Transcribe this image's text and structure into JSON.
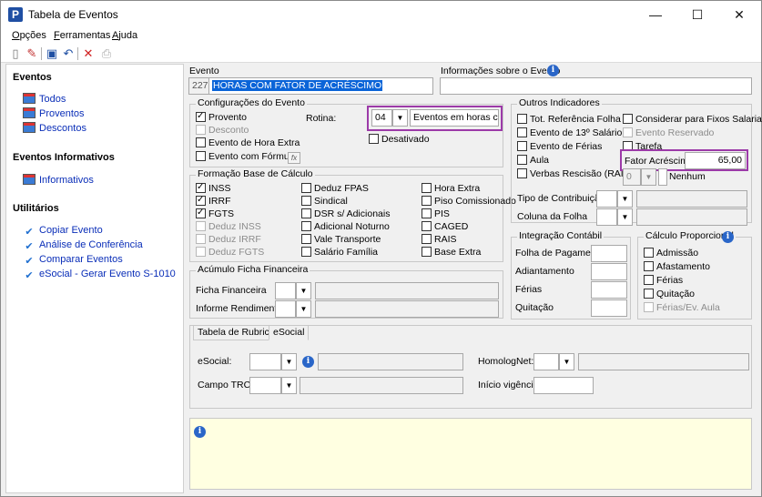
{
  "window": {
    "title": "Tabela de Eventos",
    "app_icon": "P",
    "minimize": "—",
    "maximize": "☐",
    "close": "✕"
  },
  "menu": [
    {
      "label": "Opções",
      "u": "O",
      "rest": "pções"
    },
    {
      "label": "Ferramentas",
      "u": "F",
      "rest": "erramentas"
    },
    {
      "label": "Ajuda",
      "u": "A",
      "rest": "juda"
    }
  ],
  "toolbar": {
    "icons": [
      "new-document-icon",
      "edit-icon",
      "save-icon",
      "undo-icon",
      "delete-icon",
      "print-icon"
    ]
  },
  "sidebar": {
    "eventos_head": "Eventos",
    "eventos": [
      "Todos",
      "Proventos",
      "Descontos"
    ],
    "informativos_head": "Eventos Informativos",
    "informativos": [
      "Informativos"
    ],
    "utilitarios_head": "Utilitários",
    "utilitarios": [
      "Copiar Evento",
      "Análise de Conferência",
      "Comparar Eventos",
      "eSocial - Gerar Evento S-1010"
    ]
  },
  "evento": {
    "label": "Evento",
    "code": "227",
    "name": "HORAS COM FATOR DE ACRÉSCIMO"
  },
  "info_evento": {
    "label": "Informações sobre o Evento",
    "value": ""
  },
  "config": {
    "title": "Configurações do Evento",
    "provento": "Provento",
    "desconto": "Desconto",
    "hora_extra": "Evento de Hora Extra",
    "formula": "Evento com Fórmula",
    "fx": "fx",
    "rotina_label": "Rotina:",
    "rotina_code": "04",
    "rotina_desc": "Eventos em horas com fator",
    "desativado": "Desativado"
  },
  "outros": {
    "title": "Outros Indicadores",
    "tot_ref": "Tot. Referência Folha",
    "decimo": "Evento de 13º Salário",
    "ferias": "Evento de Férias",
    "aula": "Aula",
    "verbas": "Verbas Rescisão (RAIS)",
    "considerar": "Considerar para Fixos Salariais",
    "reservado": "Evento Reservado",
    "tarefa": "Tarefa",
    "fator_label": "Fator Acréscimo",
    "fator_value": "65,00",
    "rais_code": "0",
    "rais_desc": "Nenhum",
    "tipo_contrib": "Tipo de Contribuição",
    "coluna_folha": "Coluna da Folha"
  },
  "base": {
    "title": "Formação Base de Cálculo",
    "col1": [
      "INSS",
      "IRRF",
      "FGTS",
      "Deduz INSS",
      "Deduz IRRF",
      "Deduz FGTS"
    ],
    "col2": [
      "Deduz FPAS",
      "Sindical",
      "DSR s/ Adicionais",
      "Adicional Noturno",
      "Vale Transporte",
      "Salário Família"
    ],
    "col3": [
      "Hora Extra",
      "Piso Comissionado",
      "PIS",
      "CAGED",
      "RAIS",
      "Base Extra"
    ]
  },
  "acumulo": {
    "title": "Acúmulo Ficha Financeira",
    "ficha": "Ficha Financeira",
    "informe": "Informe Rendimentos"
  },
  "integracao": {
    "title": "Integração Contábil",
    "folha": "Folha de Pagamento",
    "adiantamento": "Adiantamento",
    "ferias": "Férias",
    "quitacao": "Quitação"
  },
  "proporcional": {
    "title": "Cálculo Proporcional",
    "items": [
      "Admissão",
      "Afastamento",
      "Férias",
      "Quitação",
      "Férias/Ev. Aula"
    ]
  },
  "tabs": {
    "rubricas": "Tabela de Rubricas",
    "esocial": "eSocial"
  },
  "esocial_tab": {
    "esocial_label": "eSocial:",
    "homolognet_label": "HomologNet:",
    "trct_label": "Campo TRCT:",
    "inicio_label": "Início vigência:"
  },
  "colors": {
    "highlight": "#9c3aa8",
    "link": "#0a2eb8",
    "notes_bg": "#ffffe1",
    "selection": "#0a64d8"
  }
}
